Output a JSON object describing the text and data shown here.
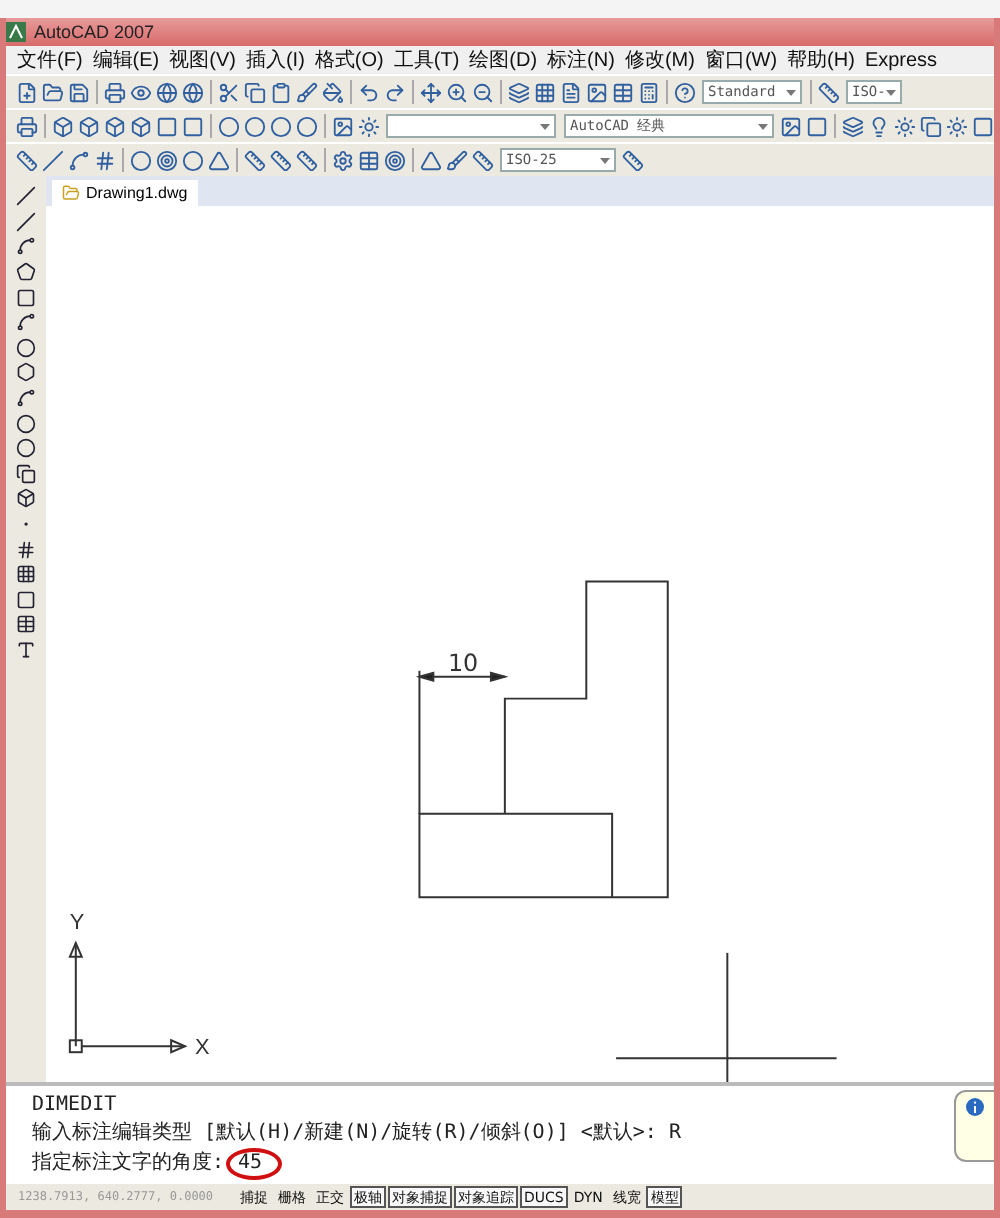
{
  "window": {
    "title": "AutoCAD 2007"
  },
  "menu": [
    "文件(F)",
    "编辑(E)",
    "视图(V)",
    "插入(I)",
    "格式(O)",
    "工具(T)",
    "绘图(D)",
    "标注(N)",
    "修改(M)",
    "窗口(W)",
    "帮助(H)",
    "Express"
  ],
  "toolbars": [
    {
      "dropdowns": [
        "Standard",
        "ISO-"
      ]
    },
    {
      "dropdowns": [
        "AutoCAD 经典"
      ]
    },
    {
      "dropdowns": [
        "ISO-25"
      ]
    }
  ],
  "document_tab": {
    "title": "Drawing1.dwg"
  },
  "drawing": {
    "dimension_text": "10",
    "ucs_x": "X",
    "ucs_y": "Y"
  },
  "command_line": {
    "history": [
      "DIMEDIT",
      "输入标注编辑类型 [默认(H)/新建(N)/旋转(R)/倾斜(O)] <默认>: R"
    ],
    "prompt": "指定标注文字的角度:",
    "value": "45"
  },
  "status_bar": {
    "coordinates": "1238.7913, 640.2777, 0.0000",
    "toggles": [
      {
        "label": "捕捉",
        "on": false
      },
      {
        "label": "栅格",
        "on": false
      },
      {
        "label": "正交",
        "on": false
      },
      {
        "label": "极轴",
        "on": true
      },
      {
        "label": "对象捕捉",
        "on": true
      },
      {
        "label": "对象追踪",
        "on": true
      },
      {
        "label": "DUCS",
        "on": true
      },
      {
        "label": "DYN",
        "on": false
      },
      {
        "label": "线宽",
        "on": false
      },
      {
        "label": "模型",
        "on": true
      }
    ]
  }
}
